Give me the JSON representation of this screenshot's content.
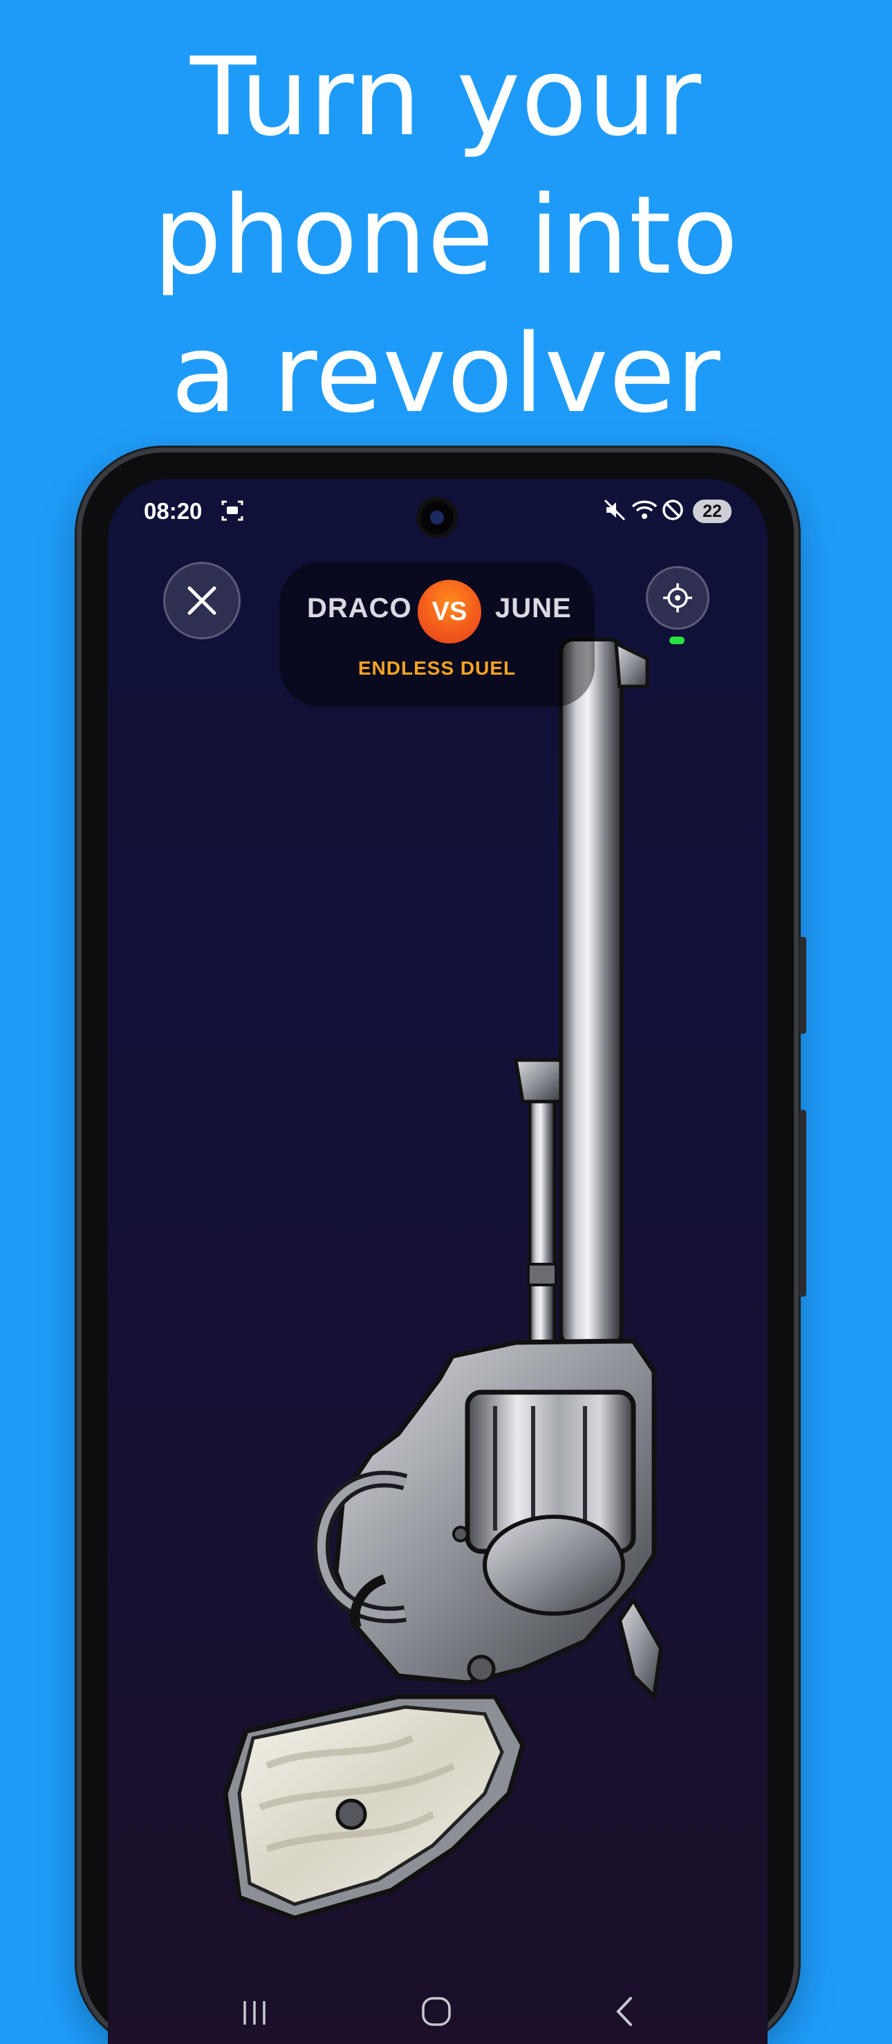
{
  "headline": {
    "line1": "Turn your",
    "line2": "phone into",
    "line3": "a revolver"
  },
  "status_bar": {
    "time": "08:20",
    "battery_level": "22",
    "icons": [
      "screenshot-icon",
      "mute-icon",
      "wifi-icon",
      "do-not-disturb-icon",
      "battery-icon"
    ]
  },
  "game": {
    "player_left": "DRACO",
    "vs_label": "VS",
    "player_right": "JUNE",
    "mode_label": "ENDLESS DUEL",
    "close_icon": "close-icon",
    "settings_icon": "crosshair-icon",
    "status_indicator_color": "#27e23d"
  },
  "nav_bar": {
    "items": [
      "recent-apps-icon",
      "home-icon",
      "back-icon"
    ]
  },
  "colors": {
    "background": "#1E9BF9",
    "vs_badge": "#f45b1b",
    "mode_label": "#f6a523"
  }
}
